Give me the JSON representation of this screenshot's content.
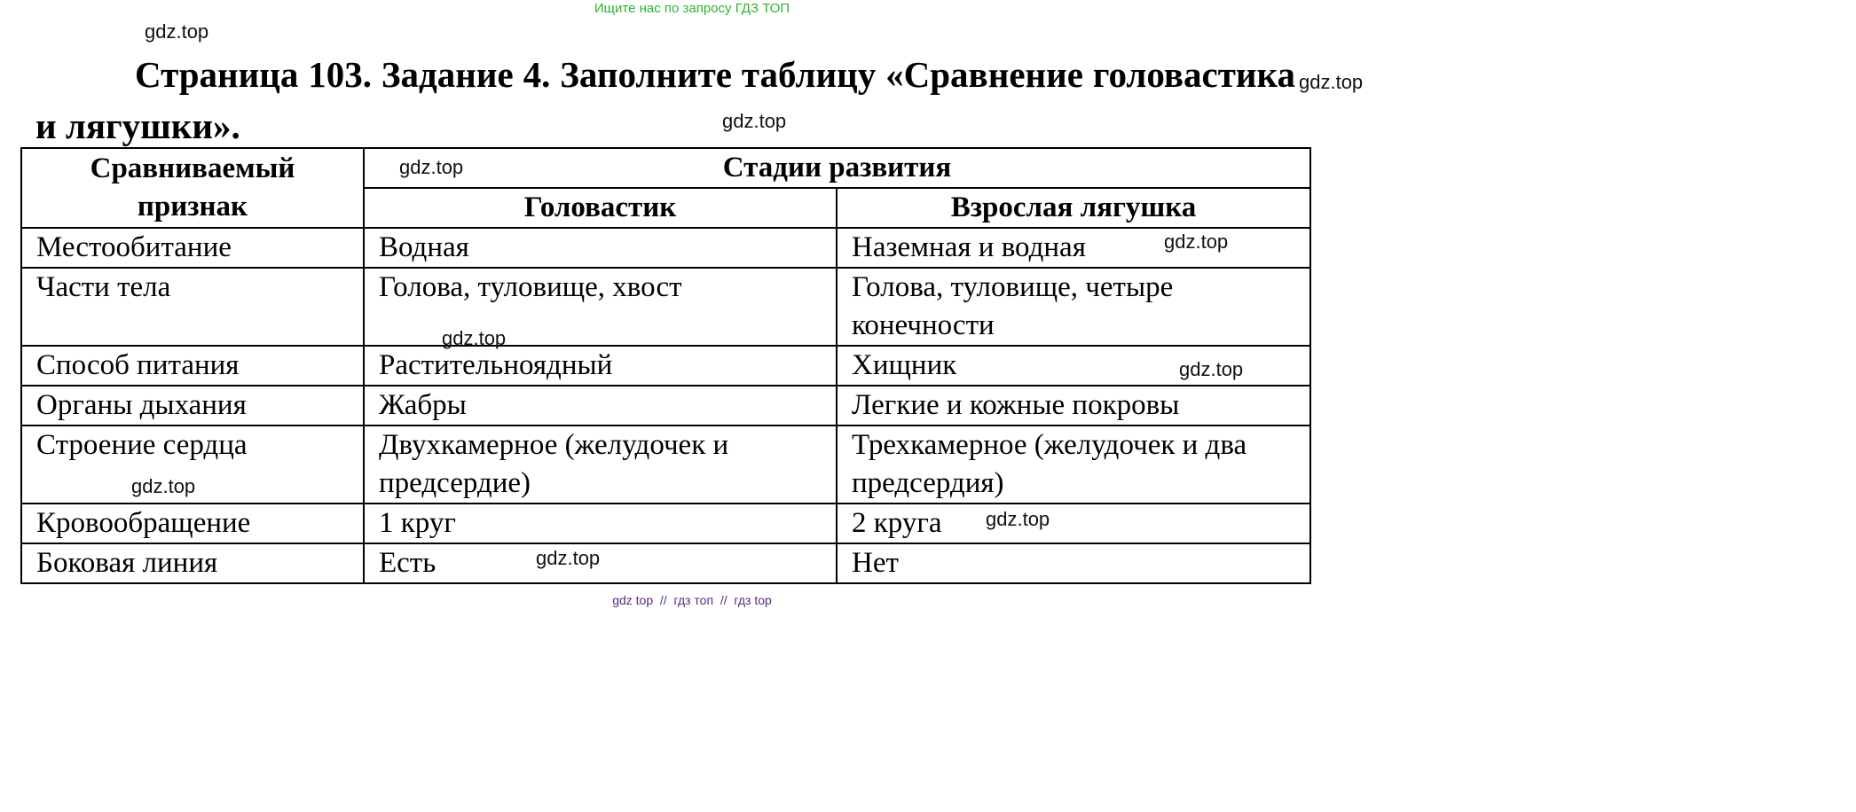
{
  "top_ad": "Ищите нас по запросу ГДЗ ТОП",
  "title": "Страница 103. Задание 4. Заполните таблицу «Сравнение головастика и лягушки».",
  "watermark": "gdz.top",
  "bottom_watermark": "gdz top  //  гдз топ  //  гдз top",
  "table": {
    "header": {
      "feature": "Сравниваемый признак",
      "stages": "Стадии развития",
      "tadpole": "Головастик",
      "frog": "Взрослая лягушка"
    },
    "rows": [
      {
        "feature": "Местообитание",
        "tadpole": "Водная",
        "frog": "Наземная и водная"
      },
      {
        "feature": "Части тела",
        "tadpole": "Голова, туловище, хвост",
        "frog": "Голова, туловище, четыре конечности"
      },
      {
        "feature": "Способ питания",
        "tadpole": "Растительноядный",
        "frog": "Хищник"
      },
      {
        "feature": "Органы дыхания",
        "tadpole": "Жабры",
        "frog": "Легкие и кожные покровы"
      },
      {
        "feature": "Строение сердца",
        "tadpole": "Двухкамерное (желудочек и предсердие)",
        "frog": "Трехкамерное (желудочек и два предсердия)"
      },
      {
        "feature": "Кровообращение",
        "tadpole": "1 круг",
        "frog": "2 круга"
      },
      {
        "feature": "Боковая линия",
        "tadpole": "Есть",
        "frog": "Нет"
      }
    ]
  }
}
